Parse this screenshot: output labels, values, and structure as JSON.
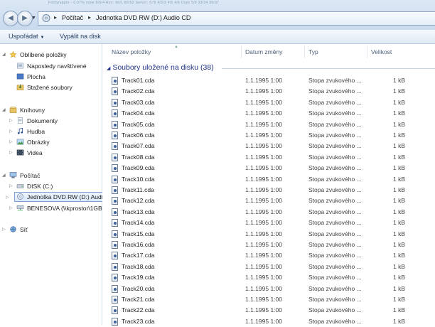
{
  "address": {
    "blur_text": "Fonty/upper - 0.07% none 8/5/4 Rev: 90/1 80/52 Server: 575 4/2/3 4/5 4/6 Uses 5/9 33/34 35/37",
    "crumbs": [
      "Počítač",
      "Jednotka DVD RW (D:) Audio CD"
    ]
  },
  "toolbar": {
    "organize_label": "Uspořádat",
    "burn_label": "Vypálit na disk"
  },
  "sidebar": {
    "favorites": {
      "label": "Oblíbené položky",
      "items": [
        {
          "label": "Naposledy navštívené"
        },
        {
          "label": "Plocha"
        },
        {
          "label": "Stažené soubory"
        }
      ]
    },
    "libraries": {
      "label": "Knihovny",
      "items": [
        {
          "label": "Dokumenty"
        },
        {
          "label": "Hudba"
        },
        {
          "label": "Obrázky"
        },
        {
          "label": "Videa"
        }
      ]
    },
    "computer": {
      "label": "Počítač",
      "items": [
        {
          "label": "DISK (C:)"
        },
        {
          "label": "Jednotka DVD RW (D:) Audio CD"
        },
        {
          "label": "BENESOVA (\\\\kprostor\\1GB"
        }
      ]
    },
    "network": {
      "label": "Síť"
    }
  },
  "columns": {
    "name": "Název položky",
    "date": "Datum změny",
    "type": "Typ",
    "size": "Velikost"
  },
  "group_header": "Soubory uložené na disku (38)",
  "files": [
    {
      "name": "Track01.cda",
      "date": "1.1.1995 1:00",
      "type": "Stopa zvukového ...",
      "size": "1 kB"
    },
    {
      "name": "Track02.cda",
      "date": "1.1.1995 1:00",
      "type": "Stopa zvukového ...",
      "size": "1 kB"
    },
    {
      "name": "Track03.cda",
      "date": "1.1.1995 1:00",
      "type": "Stopa zvukového ...",
      "size": "1 kB"
    },
    {
      "name": "Track04.cda",
      "date": "1.1.1995 1:00",
      "type": "Stopa zvukového ...",
      "size": "1 kB"
    },
    {
      "name": "Track05.cda",
      "date": "1.1.1995 1:00",
      "type": "Stopa zvukového ...",
      "size": "1 kB"
    },
    {
      "name": "Track06.cda",
      "date": "1.1.1995 1:00",
      "type": "Stopa zvukového ...",
      "size": "1 kB"
    },
    {
      "name": "Track07.cda",
      "date": "1.1.1995 1:00",
      "type": "Stopa zvukového ...",
      "size": "1 kB"
    },
    {
      "name": "Track08.cda",
      "date": "1.1.1995 1:00",
      "type": "Stopa zvukového ...",
      "size": "1 kB"
    },
    {
      "name": "Track09.cda",
      "date": "1.1.1995 1:00",
      "type": "Stopa zvukového ...",
      "size": "1 kB"
    },
    {
      "name": "Track10.cda",
      "date": "1.1.1995 1:00",
      "type": "Stopa zvukového ...",
      "size": "1 kB"
    },
    {
      "name": "Track11.cda",
      "date": "1.1.1995 1:00",
      "type": "Stopa zvukového ...",
      "size": "1 kB"
    },
    {
      "name": "Track12.cda",
      "date": "1.1.1995 1:00",
      "type": "Stopa zvukového ...",
      "size": "1 kB"
    },
    {
      "name": "Track13.cda",
      "date": "1.1.1995 1:00",
      "type": "Stopa zvukového ...",
      "size": "1 kB"
    },
    {
      "name": "Track14.cda",
      "date": "1.1.1995 1:00",
      "type": "Stopa zvukového ...",
      "size": "1 kB"
    },
    {
      "name": "Track15.cda",
      "date": "1.1.1995 1:00",
      "type": "Stopa zvukového ...",
      "size": "1 kB"
    },
    {
      "name": "Track16.cda",
      "date": "1.1.1995 1:00",
      "type": "Stopa zvukového ...",
      "size": "1 kB"
    },
    {
      "name": "Track17.cda",
      "date": "1.1.1995 1:00",
      "type": "Stopa zvukového ...",
      "size": "1 kB"
    },
    {
      "name": "Track18.cda",
      "date": "1.1.1995 1:00",
      "type": "Stopa zvukového ...",
      "size": "1 kB"
    },
    {
      "name": "Track19.cda",
      "date": "1.1.1995 1:00",
      "type": "Stopa zvukového ...",
      "size": "1 kB"
    },
    {
      "name": "Track20.cda",
      "date": "1.1.1995 1:00",
      "type": "Stopa zvukového ...",
      "size": "1 kB"
    },
    {
      "name": "Track21.cda",
      "date": "1.1.1995 1:00",
      "type": "Stopa zvukového ...",
      "size": "1 kB"
    },
    {
      "name": "Track22.cda",
      "date": "1.1.1995 1:00",
      "type": "Stopa zvukového ...",
      "size": "1 kB"
    },
    {
      "name": "Track23.cda",
      "date": "1.1.1995 1:00",
      "type": "Stopa zvukového ...",
      "size": "1 kB"
    }
  ]
}
